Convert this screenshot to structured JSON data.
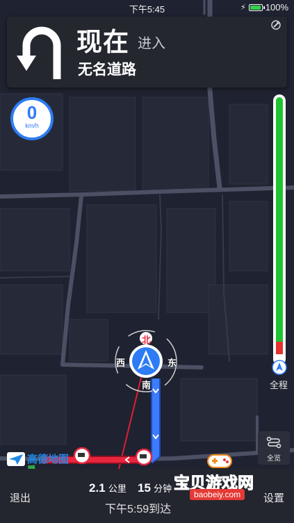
{
  "status_bar": {
    "time": "下午5:45",
    "battery": "100%",
    "battery_level": 1.0
  },
  "guidance": {
    "distance_label": "现在",
    "action": "进入",
    "road_name": "无名道路",
    "turn_icon": "u-turn-icon"
  },
  "speed": {
    "value": "0",
    "unit": "km/h"
  },
  "route_progress": {
    "label": "全程",
    "remaining_fraction": 0.9
  },
  "compass": {
    "north": "北",
    "south": "南",
    "east": "东",
    "west": "西"
  },
  "overview_button": {
    "label": "全览"
  },
  "brand": {
    "name": "高德地图"
  },
  "trip": {
    "distance_value": "2.1",
    "distance_unit": "公里",
    "time_value": "15",
    "time_unit": "分钟",
    "arrival": "下午5:59到达"
  },
  "buttons": {
    "exit": "退出",
    "settings": "设置"
  },
  "watermark": {
    "title": "宝贝游戏网",
    "url": "baobeiy.com"
  },
  "colors": {
    "route_blue": "#3d7bff",
    "route_red": "#e8263d",
    "progress_green": "#1fc330",
    "accent_blue": "#2d7cf5"
  }
}
